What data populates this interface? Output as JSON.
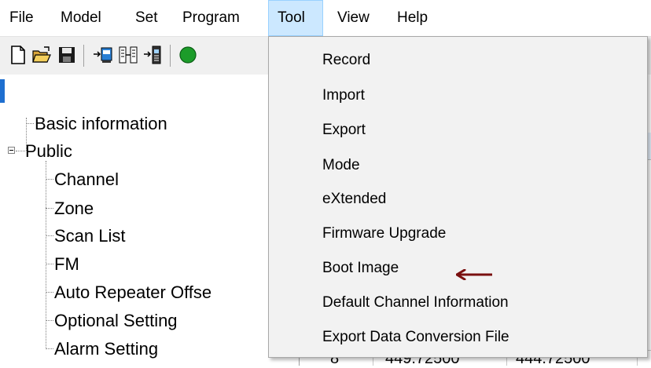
{
  "menubar": {
    "items": [
      "File",
      "Model",
      "Set",
      "Program",
      "Tool",
      "View",
      "Help"
    ],
    "active": "Tool"
  },
  "toolbar": {
    "icons": [
      "new-file-icon",
      "open-folder-icon",
      "save-icon",
      "read-from-radio-icon",
      "compare-icon",
      "write-to-radio-icon",
      "green-circle-icon"
    ]
  },
  "tree": {
    "basic_information": "Basic information",
    "public": "Public",
    "channel": "Channel",
    "zone": "Zone",
    "scan_list": "Scan List",
    "fm": "FM",
    "auto_repeater_offset": "Auto Repeater Offse",
    "optional_setting": "Optional Setting",
    "alarm_setting": "Alarm Setting"
  },
  "grid": {
    "bottom_row": [
      "8",
      "449.72500",
      "444.72500"
    ]
  },
  "tool_menu": {
    "items": [
      "Record",
      "Import",
      "Export",
      "Mode",
      "eXtended",
      "Firmware Upgrade",
      "Boot Image",
      "Default Channel Information",
      "Export Data Conversion File"
    ],
    "arrow_color": "#7a1010",
    "highlighted_hint": "Boot Image"
  },
  "colors": {
    "menu_active_bg": "#cce8ff",
    "menu_active_border": "#99d1ff",
    "dropdown_bg": "#f2f2f2"
  }
}
